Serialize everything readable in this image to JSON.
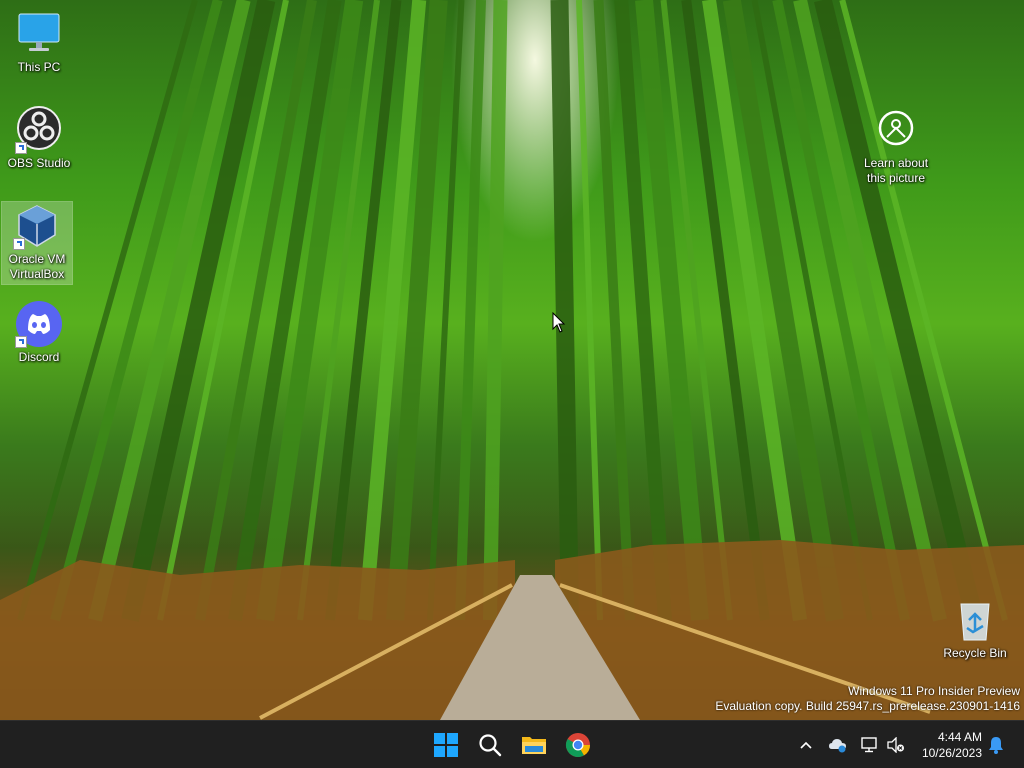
{
  "desktop": {
    "icons": [
      {
        "label": "This PC"
      },
      {
        "label": "OBS Studio"
      },
      {
        "label": "Oracle VM VirtualBox"
      },
      {
        "label": "Discord"
      },
      {
        "label": "Learn about this picture"
      },
      {
        "label": "Recycle Bin"
      }
    ],
    "watermark": {
      "line1": "Windows 11 Pro Insider Preview",
      "line2": "Evaluation copy. Build 25947.rs_prerelease.230901-1416"
    }
  },
  "taskbar": {
    "apps": [
      {
        "name": "start",
        "icon": "windows-logo-icon"
      },
      {
        "name": "search",
        "icon": "search-icon"
      },
      {
        "name": "file-explorer",
        "icon": "folder-icon"
      },
      {
        "name": "chrome",
        "icon": "chrome-icon"
      }
    ],
    "tray": {
      "time": "4:44 AM",
      "date": "10/26/2023"
    }
  },
  "colors": {
    "taskbar_bg": "#202020",
    "windows_blue": "#0a84ff",
    "discord_purple": "#5865f2"
  }
}
